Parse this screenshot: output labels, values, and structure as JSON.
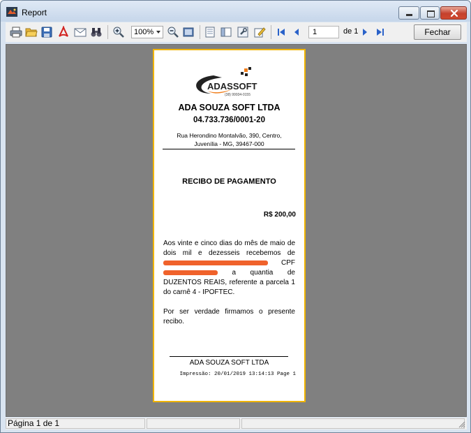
{
  "window": {
    "title": "Report"
  },
  "toolbar": {
    "icons": [
      "print-icon",
      "open-icon",
      "save-icon",
      "pdf-icon",
      "email-icon",
      "find-icon",
      "zoom-in-icon",
      "zoom-out-icon",
      "single-page-icon",
      "page-setup-icon",
      "thumbnails-icon",
      "settings-icon",
      "edit-icon",
      "first-page-icon",
      "previous-page-icon",
      "next-page-icon",
      "last-page-icon"
    ],
    "zoom": "100%",
    "current_page": "1",
    "page_of": "de 1",
    "close_label": "Fechar"
  },
  "receipt": {
    "logo_text": "ADASSOFT",
    "logo_phone": "(38) 99934-0155",
    "company": "ADA SOUZA SOFT LTDA",
    "cnpj": "04.733.736/0001-20",
    "address_line1": "Rua Herondino Montalvão, 390, Centro,",
    "address_line2": "Juvenília - MG, 39467-000",
    "title": "RECIBO DE PAGAMENTO",
    "amount": "R$ 200,00",
    "para1_start": "Aos vinte e cinco dias do mês de maio de dois mil e dezesseis recebemos de",
    "cpf_label": "CPF",
    "quantia": "a quantia de",
    "para1_end": "DUZENTOS REAIS, referente a parcela 1 do carnê 4 - IPOFTEC.",
    "para2": "Por ser verdade firmamos o presente recibo.",
    "signature_name": "ADA SOUZA SOFT LTDA",
    "impressao": "Impressão: 20/01/2019 13:14:13 Page 1"
  },
  "colors": {
    "paper_border": "#f0b400",
    "preview_bg": "#808080",
    "redaction": "#f0622b",
    "logo_orange": "#f07d1a"
  },
  "statusbar": {
    "page_text": "Página 1 de 1"
  }
}
